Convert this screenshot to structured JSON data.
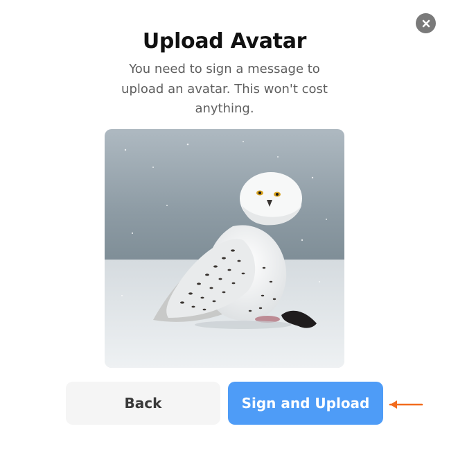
{
  "modal": {
    "title": "Upload Avatar",
    "description": "You need to sign a message to upload an avatar. This won't cost anything.",
    "close_icon": "close-icon",
    "image": "snowy-owl-photo",
    "back_label": "Back",
    "sign_label": "Sign and Upload"
  },
  "colors": {
    "primary_button": "#4e9cf7",
    "secondary_button": "#f5f5f5",
    "close_button": "#7a7a7a",
    "annotation_arrow": "#f26b1d"
  }
}
